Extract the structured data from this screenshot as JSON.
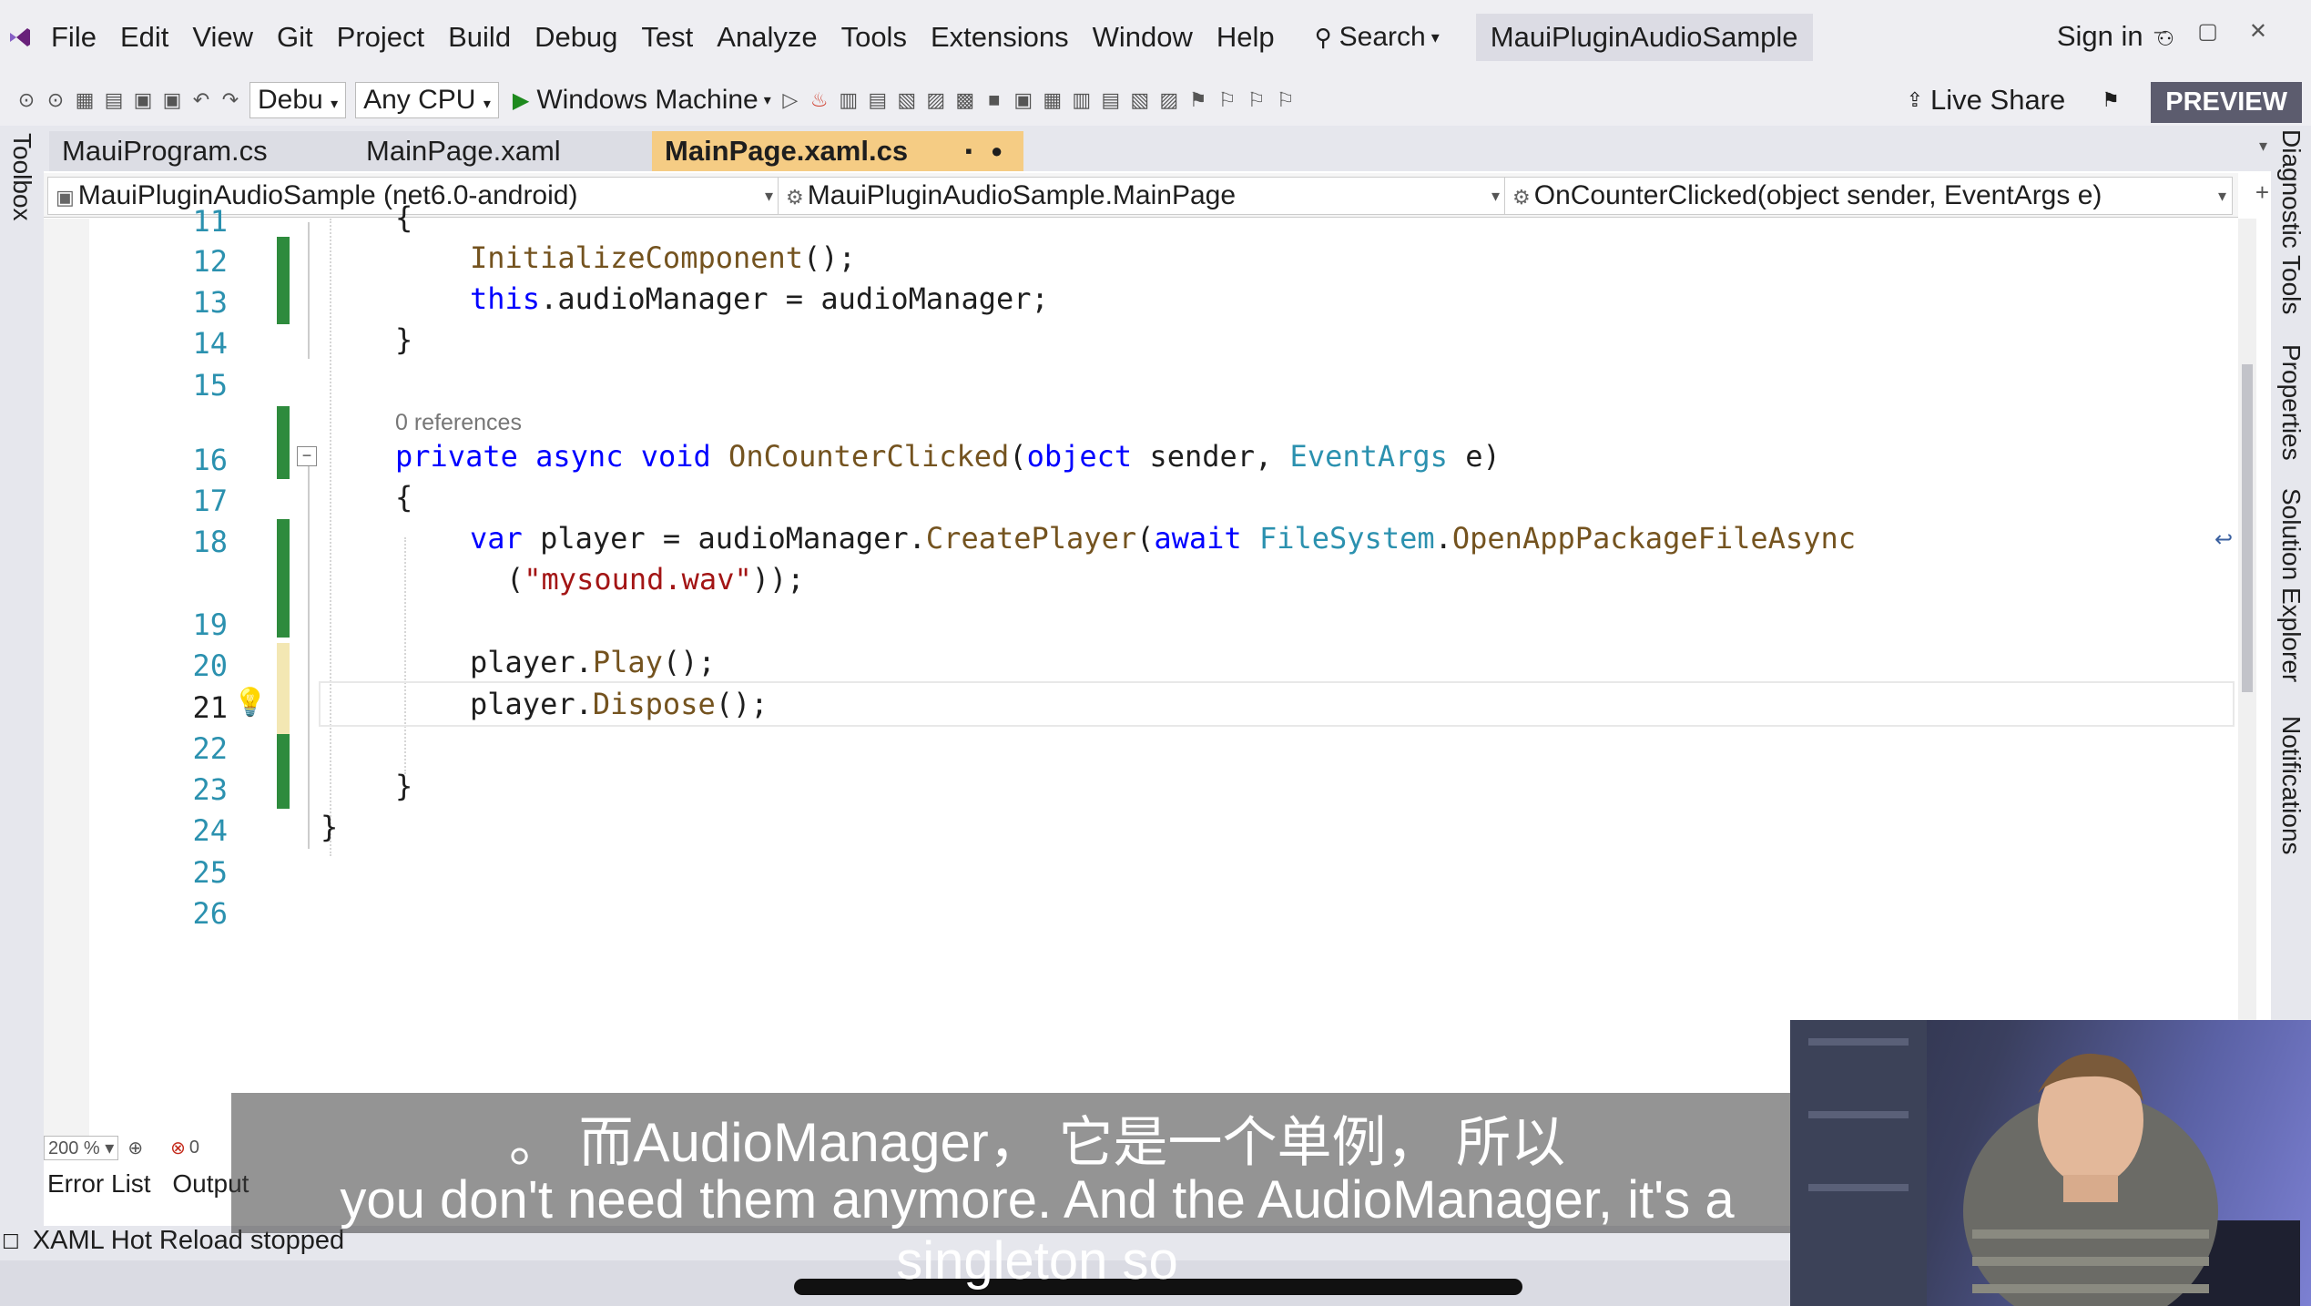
{
  "menubar": {
    "items": [
      "File",
      "Edit",
      "View",
      "Git",
      "Project",
      "Build",
      "Debug",
      "Test",
      "Analyze",
      "Tools",
      "Extensions",
      "Window",
      "Help"
    ],
    "search_label": "Search",
    "solution_title": "MauiPluginAudioSample",
    "sign_in": "Sign in"
  },
  "toolbar": {
    "config": "Debu",
    "platform": "Any CPU",
    "run_target": "Windows Machine",
    "live_share": "Live Share",
    "preview": "PREVIEW"
  },
  "side": {
    "toolbox": "Toolbox",
    "right_tabs": [
      "Diagnostic Tools",
      "Properties",
      "Solution Explorer",
      "Notifications"
    ]
  },
  "tabs": [
    {
      "label": "MauiProgram.cs",
      "active": false
    },
    {
      "label": "MainPage.xaml",
      "active": false
    },
    {
      "label": "MainPage.xaml.cs",
      "active": true
    }
  ],
  "navbar": {
    "project": "MauiPluginAudioSample (net6.0-android)",
    "type": "MauiPluginAudioSample.MainPage",
    "member": "OnCounterClicked(object sender, EventArgs e)"
  },
  "editor": {
    "line_numbers": [
      "11",
      "12",
      "13",
      "14",
      "15",
      "16",
      "17",
      "18",
      "19",
      "20",
      "21",
      "22",
      "23",
      "24",
      "25",
      "26"
    ],
    "codelens": "0 references",
    "code": {
      "l11": "{",
      "l12_fn": "InitializeComponent",
      "l12_rest": "();",
      "l13_kw": "this",
      "l13_rest": ".audioManager = audioManager;",
      "l14": "}",
      "l16_kw": "private async void ",
      "l16_fn": "OnCounterClicked",
      "l16_p1": "(",
      "l16_kw2": "object",
      "l16_p2": " sender, ",
      "l16_ty": "EventArgs",
      "l16_p3": " e)",
      "l17": "{",
      "l18_kw": "var",
      "l18_a": " player = audioManager.",
      "l18_fn": "CreatePlayer",
      "l18_b": "(",
      "l18_kw2": "await",
      "l18_sp": " ",
      "l18_ty": "FileSystem",
      "l18_dot": ".",
      "l18_fn2": "OpenAppPackageFileAsync",
      "l18c_a": "(",
      "l18c_str": "\"mysound.wav\"",
      "l18c_b": "));",
      "l20_a": "player.",
      "l20_fn": "Play",
      "l20_b": "();",
      "l21_a": "player.",
      "l21_fn": "Dispose",
      "l21_b": "();",
      "l23": "}",
      "l24": "}"
    }
  },
  "status": {
    "zoom": "200 %",
    "errors": "0"
  },
  "panels": {
    "error_list": "Error List",
    "output": "Output"
  },
  "hot_reload": "XAML Hot Reload stopped",
  "subtitles": {
    "zh": "。 而AudioManager， 它是一个单例， 所以",
    "en": "you don't need them anymore. And the AudioManager, it's a singleton so"
  },
  "colors": {
    "keyword": "#0000ff",
    "type": "#2b91af",
    "method": "#74531f",
    "string": "#a31515",
    "active_tab": "#f5cc84",
    "change_bar": "#2e8b3d"
  }
}
